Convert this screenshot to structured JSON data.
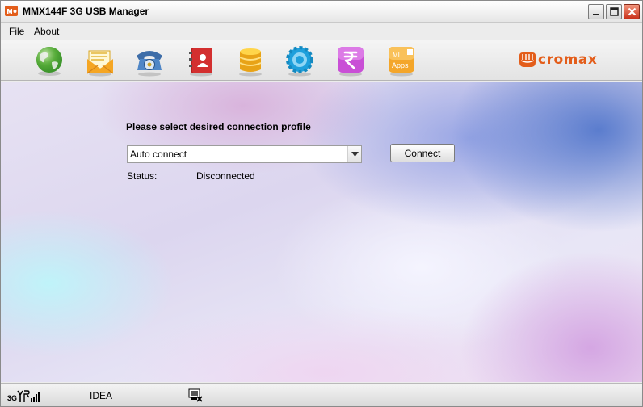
{
  "window": {
    "title": "MMX144F 3G USB Manager",
    "app_icon": "micromax-logo-icon",
    "controls": [
      "minimize-icon",
      "maximize-icon",
      "close-icon"
    ]
  },
  "menu": {
    "items": [
      {
        "label": "File"
      },
      {
        "label": "About"
      }
    ]
  },
  "toolbar": {
    "tools": [
      {
        "icon": "globe-internet-icon"
      },
      {
        "icon": "sms-envelope-icon"
      },
      {
        "icon": "telephone-icon"
      },
      {
        "icon": "contacts-book-icon"
      },
      {
        "icon": "database-storage-icon"
      },
      {
        "icon": "settings-gear-icon"
      },
      {
        "icon": "rupee-recharge-icon"
      },
      {
        "icon": "mi-apps-icon",
        "label_line1": "MI",
        "label_line2": "Apps"
      }
    ],
    "brand": {
      "text": "cromax",
      "color": "#e35d1a"
    }
  },
  "connection": {
    "prompt": "Please select desired connection profile",
    "profile_selected": "Auto connect",
    "connect_label": "Connect",
    "status_label": "Status:",
    "status_value": "Disconnected"
  },
  "statusbar": {
    "network_type": "3G",
    "signal_icon": "signal-strength-icon",
    "operator": "IDEA",
    "device_icon": "device-disconnected-icon"
  },
  "colors": {
    "close_button": "#c9311a",
    "brand_orange": "#e35d1a"
  }
}
